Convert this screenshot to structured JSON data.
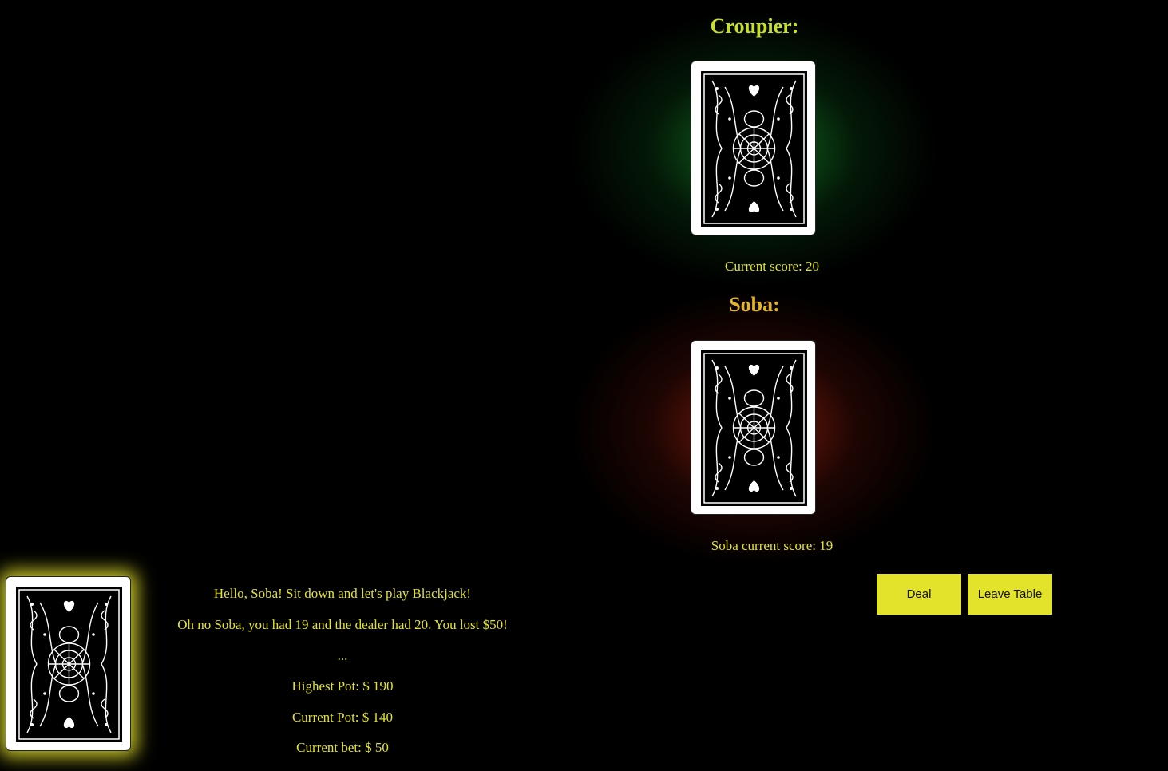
{
  "dealer": {
    "heading": "Croupier:",
    "score_text": "Current score: 20",
    "card": "card-back"
  },
  "player": {
    "heading": "Soba:",
    "score_text": "Soba current score: 19",
    "card": "card-back"
  },
  "deck": {
    "card": "card-back"
  },
  "messages": {
    "greeting": "Hello, Soba! Sit down and let's play Blackjack!",
    "result": "Oh no Soba, you had 19 and the dealer had 20. You lost $50!",
    "ellipsis": "...",
    "highest_pot": "Highest Pot: $ 190",
    "current_pot": "Current Pot: $ 140",
    "current_bet": "Current bet: $ 50"
  },
  "actions": {
    "deal": "Deal",
    "leave": "Leave Table"
  },
  "colors": {
    "dealer_heading": "#c8df2a",
    "player_heading": "#e3b52a",
    "text": "#e4e32c",
    "button_bg": "#e4e32c",
    "dealer_glow": "#168228",
    "player_glow": "#8c1e0e",
    "deck_glow": "#e4e22d"
  }
}
